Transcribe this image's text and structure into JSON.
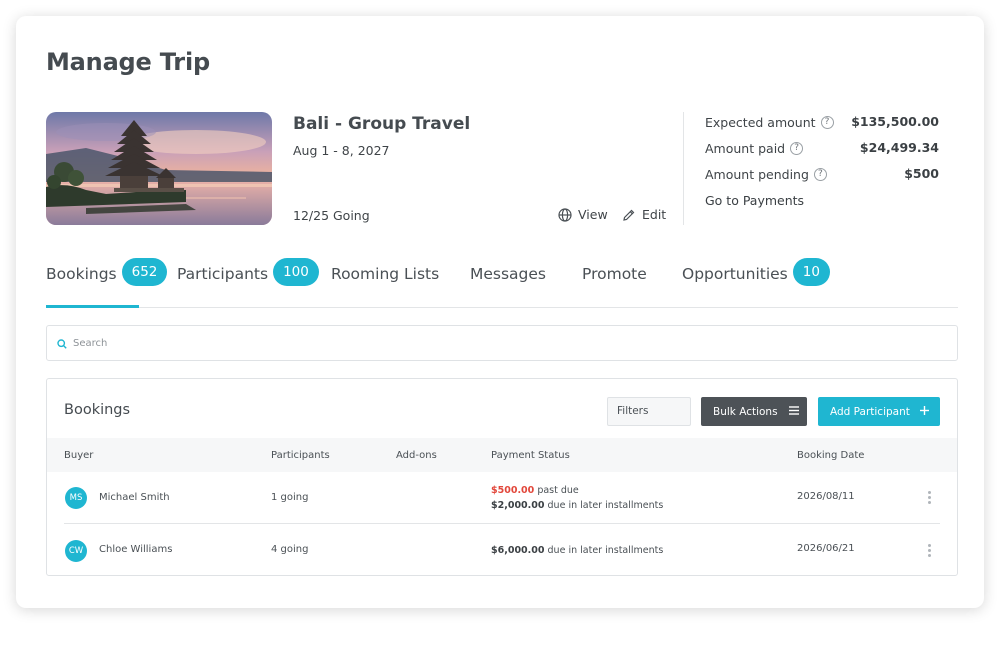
{
  "page": {
    "title": "Manage Trip"
  },
  "trip": {
    "name": "Bali - Group Travel",
    "dates": "Aug 1 - 8, 2027",
    "going": "12/25 Going",
    "view_label": "View",
    "edit_label": "Edit"
  },
  "summary": {
    "expected_label": "Expected amount",
    "expected_value": "$135,500.00",
    "paid_label": "Amount paid",
    "paid_value": "$24,499.34",
    "pending_label": "Amount pending",
    "pending_value": "$500",
    "help_glyph": "?",
    "go_to_payments": "Go to Payments"
  },
  "tabs": [
    {
      "label": "Bookings",
      "badge": "652",
      "active": true
    },
    {
      "label": "Participants",
      "badge": "100"
    },
    {
      "label": "Rooming Lists"
    },
    {
      "label": "Messages"
    },
    {
      "label": "Promote"
    },
    {
      "label": "Opportunities",
      "badge": "10"
    }
  ],
  "search": {
    "placeholder": "Search"
  },
  "bookings": {
    "title": "Bookings",
    "filters_label": "Filters",
    "bulk_actions_label": "Bulk Actions",
    "add_participant_label": "Add Participant",
    "columns": [
      "Buyer",
      "Participants",
      "Add-ons",
      "Payment Status",
      "Booking Date"
    ],
    "rows": [
      {
        "initials": "MS",
        "buyer": "Michael Smith",
        "participants": "1 going",
        "addons": "",
        "payment_line1_amount": "$500.00",
        "payment_line1_text": "past due",
        "payment_line2_amount": "$2,000.00",
        "payment_line2_text": "due in later installments",
        "booking_date": "2026/08/11"
      },
      {
        "initials": "CW",
        "buyer": "Chloe Williams",
        "participants": "4 going",
        "addons": "",
        "payment_line1_amount": "$6,000.00",
        "payment_line1_text": "due in later installments",
        "booking_date": "2026/06/21"
      }
    ]
  },
  "colors": {
    "accent": "#1fb6d1",
    "past_due": "#e2473b",
    "dark_button": "#4d5257"
  }
}
